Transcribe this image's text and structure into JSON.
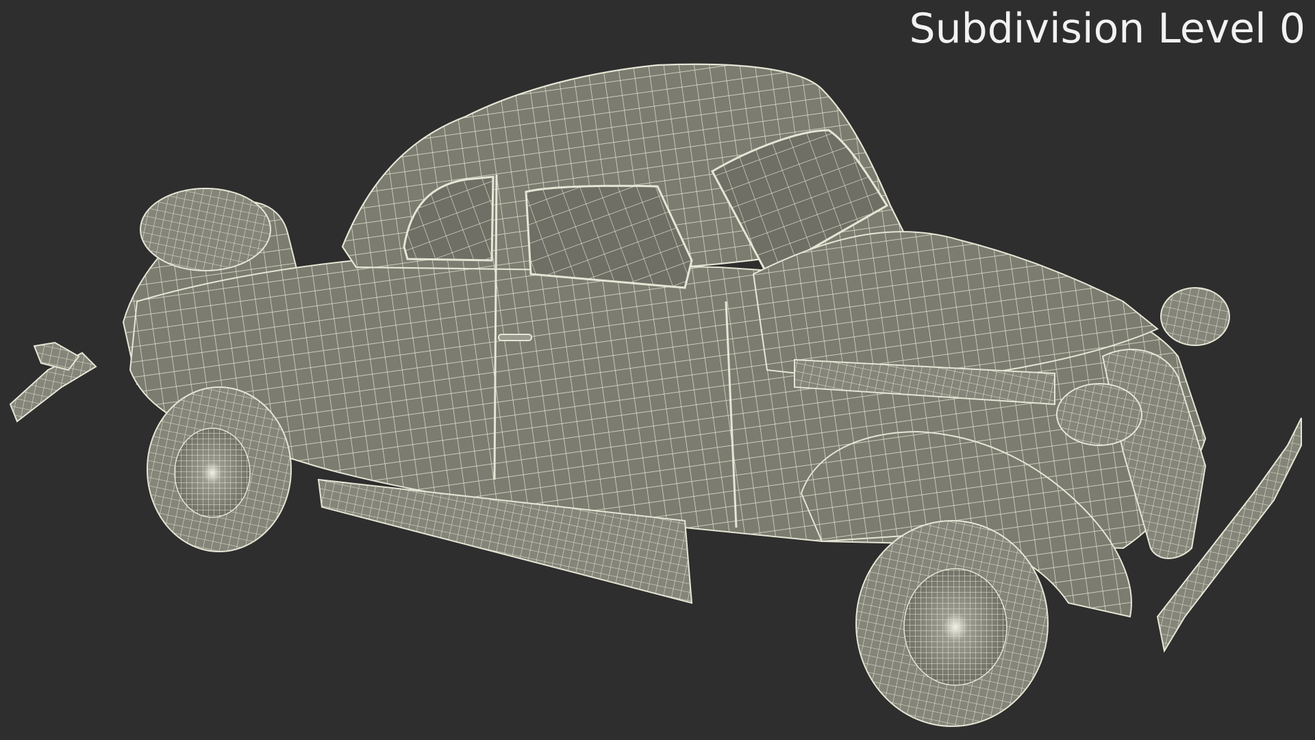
{
  "render_label": "Subdivision Level 0",
  "colors": {
    "background": "#2e2e2e",
    "body_fill": "#7c7c70",
    "wire": "#e6e6d6",
    "label_text": "#f2f2f2"
  }
}
